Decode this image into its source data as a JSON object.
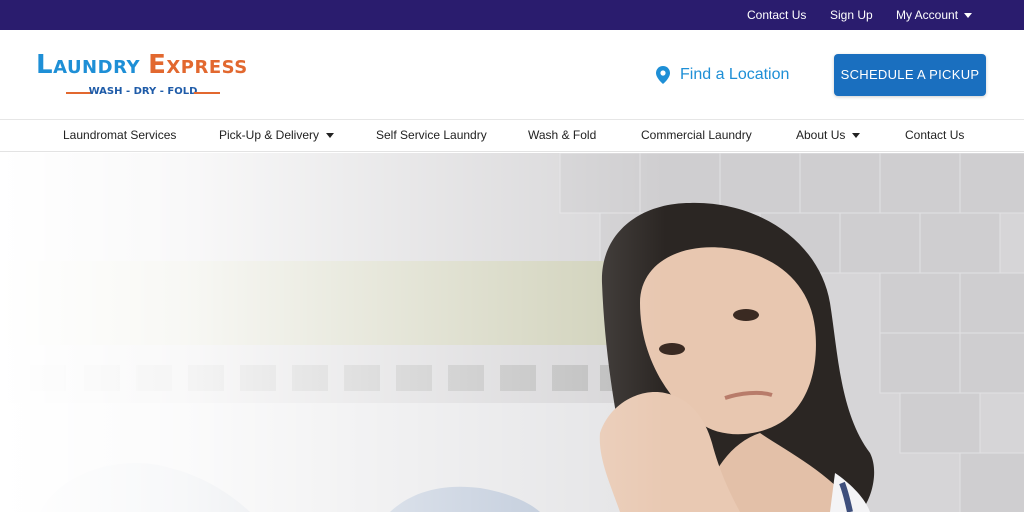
{
  "topbar": {
    "links": [
      "Contact Us",
      "Sign Up",
      "My Account"
    ]
  },
  "logo": {
    "word1": "Laundry",
    "word2": "Express",
    "tagline": "WASH - DRY - FOLD"
  },
  "header": {
    "find_location": "Find a Location",
    "schedule_button": "SCHEDULE A PICKUP"
  },
  "nav": {
    "items": [
      {
        "label": "Laundromat Services"
      },
      {
        "label": "Pick-Up & Delivery"
      },
      {
        "label": "Self Service Laundry"
      },
      {
        "label": "Wash & Fold"
      },
      {
        "label": "Commercial Laundry"
      },
      {
        "label": "About Us"
      },
      {
        "label": "Contact Us"
      }
    ]
  },
  "colors": {
    "topbar": "#2a1c6e",
    "brand_blue": "#1e8fd6",
    "brand_orange": "#e2682f",
    "button": "#1a6fbf"
  },
  "icons": {
    "location": "map-pin-icon",
    "dropdown": "caret-down-icon"
  }
}
